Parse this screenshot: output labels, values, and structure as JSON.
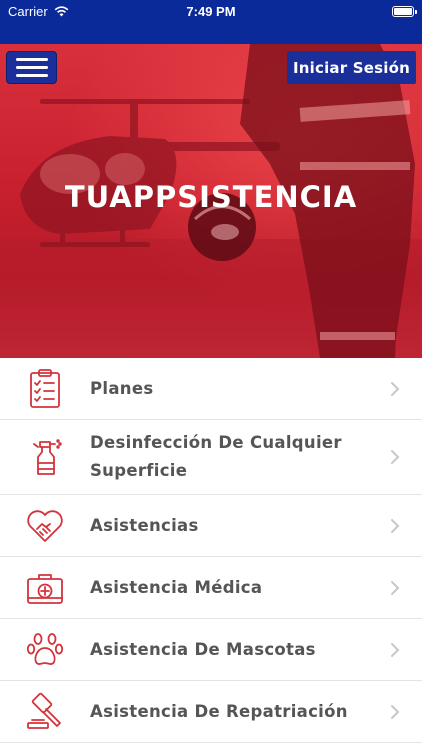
{
  "status_bar": {
    "carrier": "Carrier",
    "time": "7:49 PM"
  },
  "header": {
    "login_label": "Iniciar Sesión"
  },
  "hero": {
    "title": "TUAPPSISTENCIA"
  },
  "menu": {
    "items": [
      {
        "label": "Planes",
        "icon": "checklist-icon"
      },
      {
        "label": "Desinfección De Cualquier Superficie",
        "icon": "spray-bottle-icon"
      },
      {
        "label": "Asistencias",
        "icon": "handshake-heart-icon"
      },
      {
        "label": "Asistencia Médica",
        "icon": "medical-kit-icon"
      },
      {
        "label": "Asistencia De Mascotas",
        "icon": "paw-icon"
      },
      {
        "label": "Asistencia De Repatriación",
        "icon": "gavel-icon"
      }
    ]
  },
  "colors": {
    "brand_blue": "#1a2f99",
    "brand_red": "#d8303c",
    "icon_red": "#d3343b",
    "text_gray": "#555555"
  }
}
